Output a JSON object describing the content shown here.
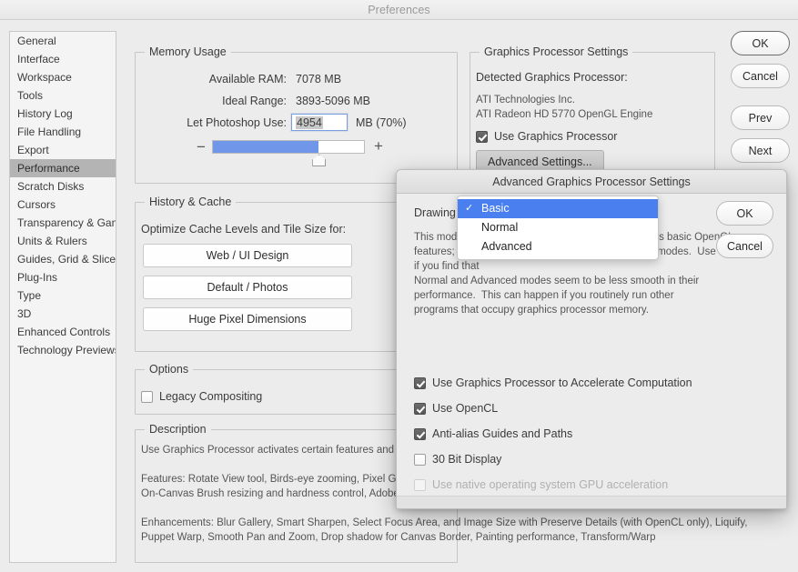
{
  "window": {
    "title": "Preferences"
  },
  "sidebar": {
    "items": [
      {
        "label": "General",
        "selected": false
      },
      {
        "label": "Interface",
        "selected": false
      },
      {
        "label": "Workspace",
        "selected": false
      },
      {
        "label": "Tools",
        "selected": false
      },
      {
        "label": "History Log",
        "selected": false
      },
      {
        "label": "File Handling",
        "selected": false
      },
      {
        "label": "Export",
        "selected": false
      },
      {
        "label": "Performance",
        "selected": true
      },
      {
        "label": "Scratch Disks",
        "selected": false
      },
      {
        "label": "Cursors",
        "selected": false
      },
      {
        "label": "Transparency & Gamut",
        "selected": false
      },
      {
        "label": "Units & Rulers",
        "selected": false
      },
      {
        "label": "Guides, Grid & Slices",
        "selected": false
      },
      {
        "label": "Plug-Ins",
        "selected": false
      },
      {
        "label": "Type",
        "selected": false
      },
      {
        "label": "3D",
        "selected": false
      },
      {
        "label": "Enhanced Controls",
        "selected": false
      },
      {
        "label": "Technology Previews",
        "selected": false
      }
    ]
  },
  "memory_usage": {
    "legend": "Memory Usage",
    "available_ram_label": "Available RAM:",
    "available_ram_value": "7078 MB",
    "ideal_range_label": "Ideal Range:",
    "ideal_range_value": "3893-5096 MB",
    "let_use_label": "Let Photoshop Use:",
    "let_use_value": "4954",
    "unit_suffix": "MB (70%)",
    "minus_label": "−",
    "plus_label": "+",
    "slider_percent": 70
  },
  "history_cache": {
    "legend": "History & Cache",
    "optimize_label": "Optimize Cache Levels and Tile Size for:",
    "buttons": [
      "Web / UI Design",
      "Default / Photos",
      "Huge Pixel Dimensions"
    ]
  },
  "options": {
    "legend": "Options",
    "legacy_compositing_label": "Legacy Compositing",
    "legacy_compositing_checked": false
  },
  "description": {
    "legend": "Description",
    "body": "Use Graphics Processor activates certain features and interface enhancements for use with open documents.\n\nFeatures: Rotate View tool, Birds-eye zooming, Pixel Grid, Flick Panning, Scrubby Zoom, HUD Color Sampling Ring (Eyedropper Tool), On-Canvas Brush resizing and hardness control, Adobe Color Engine, all of 3D\n\nEnhancements: Blur Gallery, Smart Sharpen, Select Focus Area, and Image Size with Preserve Details (with OpenCL only), Liquify, Puppet Warp, Smooth Pan and Zoom, Drop shadow for Canvas Border, Painting performance, Transform/Warp"
  },
  "gpu_settings": {
    "legend": "Graphics Processor Settings",
    "detected_label": "Detected Graphics Processor:",
    "vendor": "ATI Technologies Inc.",
    "device": "ATI Radeon HD 5770 OpenGL Engine",
    "use_gpu_label": "Use Graphics Processor",
    "use_gpu_checked": true,
    "advanced_button": "Advanced Settings..."
  },
  "dialog_buttons": [
    {
      "label": "OK",
      "default": true
    },
    {
      "label": "Cancel",
      "default": false
    },
    {
      "label": "Prev",
      "default": false
    },
    {
      "label": "Next",
      "default": false
    }
  ],
  "advanced_dialog": {
    "title": "Advanced Graphics Processor Settings",
    "drawing_mode_label": "Drawing Mode:",
    "drawing_mode_value": "Basic",
    "drawing_mode_options": [
      {
        "label": "Basic",
        "selected": true
      },
      {
        "label": "Normal",
        "selected": false
      },
      {
        "label": "Advanced",
        "selected": false
      }
    ],
    "checkmark_glyph": "✓",
    "chevron_glyph": "▾",
    "mode_description": "This mode uses the least amount of memory and runs basic OpenGL features; typically and the most basic of the drawing modes.  Use this mode if you find that\nNormal and Advanced modes seem to be less smooth in their\nperformance.  This can happen if you routinely run other\nprograms that occupy graphics processor memory.",
    "checkboxes": [
      {
        "label": "Use Graphics Processor to Accelerate Computation",
        "checked": true,
        "disabled": false
      },
      {
        "label": "Use OpenCL",
        "checked": true,
        "disabled": false
      },
      {
        "label": "Anti-alias Guides and Paths",
        "checked": true,
        "disabled": false
      },
      {
        "label": "30 Bit Display",
        "checked": false,
        "disabled": false
      },
      {
        "label": "Use native operating system GPU acceleration",
        "checked": false,
        "disabled": true
      }
    ],
    "buttons": [
      {
        "label": "OK"
      },
      {
        "label": "Cancel"
      }
    ]
  },
  "colors": {
    "accent_blue": "#4a7ff0",
    "slider_fill": "#6f96e8",
    "selection_gray": "#b4b4b4",
    "window_bg": "#ececec"
  }
}
